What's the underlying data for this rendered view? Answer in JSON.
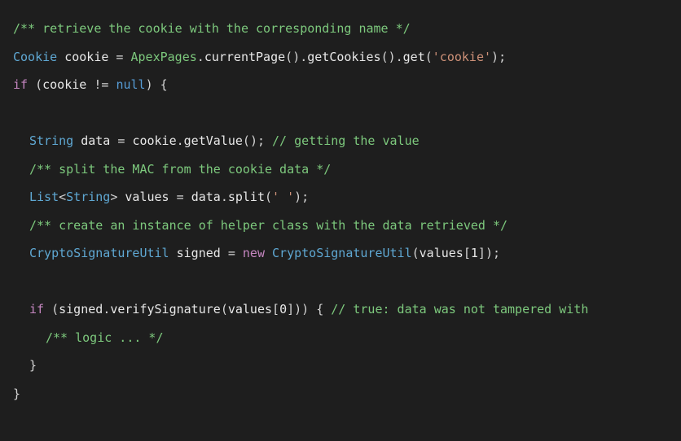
{
  "code": {
    "c1": "/** retrieve the cookie with the corresponding name */",
    "t_cookie": "Cookie",
    "v_cookie": "cookie",
    "eq": " = ",
    "apex": "ApexPages",
    "dot": ".",
    "currentPage": "currentPage",
    "getCookies": "getCookies",
    "get": "get",
    "parenO": "(",
    "parenC": ")",
    "str_cookie": "'cookie'",
    "semi": ";",
    "if": "if",
    "neq": " != ",
    "null": "null",
    "braceO": " {",
    "braceC": "}",
    "t_string": "String",
    "v_data": "data",
    "getValue": "getValue",
    "c2": "// getting the value",
    "c3": "/** split the MAC from the cookie data */",
    "t_list": "List",
    "lt": "<",
    "gt": ">",
    "v_values": "values",
    "split": "split",
    "str_space": "' '",
    "c4": "/** create an instance of helper class with the data retrieved */",
    "t_crypto": "CryptoSignatureUtil",
    "v_signed": "signed",
    "new": "new",
    "bracketO": "[",
    "bracketC": "]",
    "n1": "1",
    "n0": "0",
    "verifySignature": "verifySignature",
    "c5": "// true: data was not tampered with",
    "c6": "/** logic ... */",
    "sp": " "
  }
}
